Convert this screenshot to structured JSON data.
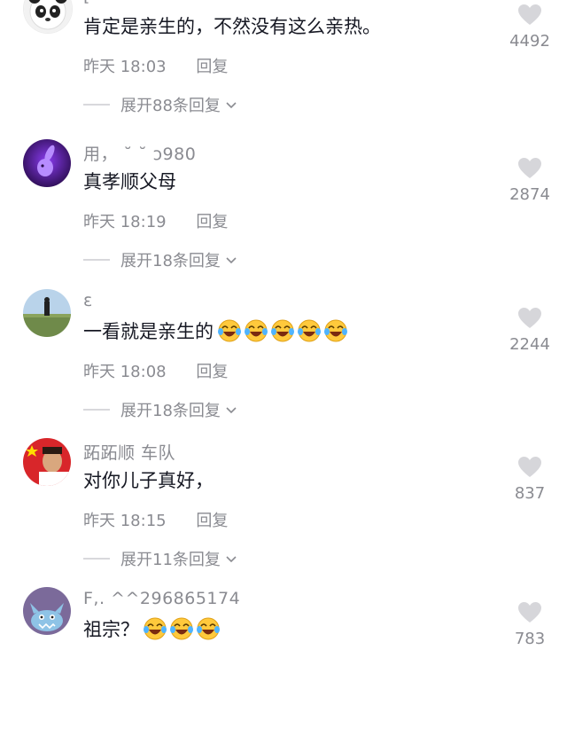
{
  "comments": [
    {
      "username": "[",
      "text": "肯定是亲生的，不然没有这么亲热。",
      "emoji_count": 0,
      "time": "昨天 18:03",
      "reply_label": "回复",
      "expand_label": "展开88条回复",
      "likes": "4492",
      "avatar": "panda-avatar"
    },
    {
      "username": "用，  ˘ ˘     ͻ980",
      "text": "真孝顺父母",
      "emoji_count": 0,
      "time": "昨天 18:19",
      "reply_label": "回复",
      "expand_label": "展开18条回复",
      "likes": "2874",
      "avatar": "purple-rabbit-avatar"
    },
    {
      "username": "ɛ",
      "text": "一看就是亲生的",
      "emoji_count": 5,
      "time": "昨天 18:08",
      "reply_label": "回复",
      "expand_label": "展开18条回复",
      "likes": "2244",
      "avatar": "landscape-avatar"
    },
    {
      "username": "跖跖顺  车队",
      "text": "对你儿子真好，",
      "emoji_count": 0,
      "time": "昨天 18:15",
      "reply_label": "回复",
      "expand_label": "展开11条回复",
      "likes": "837",
      "avatar": "flag-man-avatar"
    },
    {
      "username": "F,.          ^^296865174",
      "text": "祖宗？",
      "emoji_count": 3,
      "time": "",
      "reply_label": "",
      "expand_label": "",
      "likes": "783",
      "avatar": "monster-avatar"
    }
  ],
  "colors": {
    "primary_text": "#161823",
    "secondary_text": "#8a8b91",
    "heart": "#d6d6da",
    "emoji_face": "#ffc93c"
  },
  "icons": {
    "like": "heart-icon",
    "expand": "chevron-down-icon",
    "emoji": "laughing-crying-emoji-icon"
  }
}
